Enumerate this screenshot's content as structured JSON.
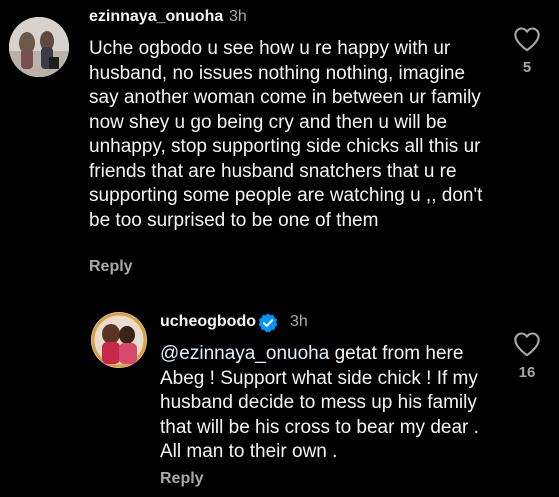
{
  "comments": [
    {
      "username": "ezinnaya_onuoha",
      "time": "3h",
      "text": "Uche ogbodo u see how u re happy with ur husband, no issues nothing nothing, imagine say another woman come in between ur family now shey u go being cry and then u will be unhappy, stop supporting side chicks all this ur friends that are husband snatchers that u re supporting some people are watching u ,, don't be too surprised to be one of them",
      "reply_label": "Reply",
      "likes": "5"
    },
    {
      "username": "ucheogbodo",
      "time": "3h",
      "mention": "@ezinnaya_onuoha",
      "text": " getat from here Abeg ! Support what side chick ! If my husband decide to mess up his family that will be his cross to bear my dear . All man to their own .",
      "reply_label": "Reply",
      "likes": "16",
      "verified": true
    }
  ],
  "colors": {
    "background": "#000000",
    "text": "#f5f5f5",
    "secondary": "#a8a8a8",
    "verified_badge": "#0095f6",
    "mention": "#e0f1ff"
  },
  "icons": [
    "heart-icon",
    "verified-badge-icon"
  ]
}
